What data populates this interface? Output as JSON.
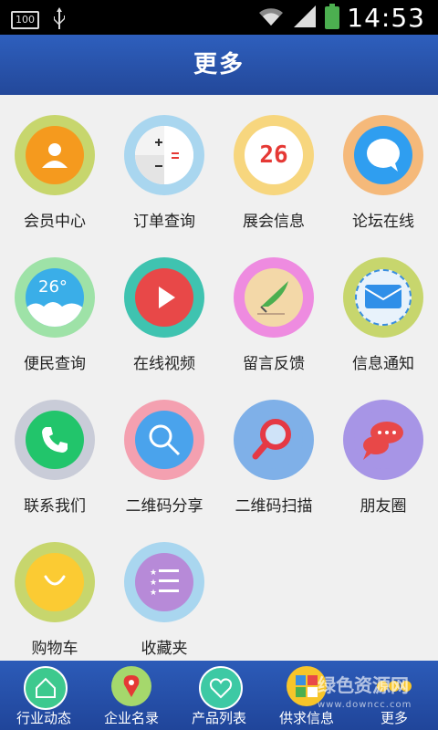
{
  "status_bar": {
    "battery": "100",
    "time": "14:53"
  },
  "header": {
    "title": "更多"
  },
  "grid": {
    "items": [
      {
        "label": "会员中心"
      },
      {
        "label": "订单查询"
      },
      {
        "label": "展会信息",
        "badge": "26"
      },
      {
        "label": "论坛在线"
      },
      {
        "label": "便民查询",
        "temp": "26°"
      },
      {
        "label": "在线视频"
      },
      {
        "label": "留言反馈"
      },
      {
        "label": "信息通知"
      },
      {
        "label": "联系我们"
      },
      {
        "label": "二维码分享"
      },
      {
        "label": "二维码扫描"
      },
      {
        "label": "朋友圈"
      },
      {
        "label": "购物车"
      },
      {
        "label": "收藏夹"
      }
    ]
  },
  "bottom_nav": {
    "items": [
      {
        "label": "行业动态"
      },
      {
        "label": "企业名录"
      },
      {
        "label": "产品列表"
      },
      {
        "label": "供求信息"
      },
      {
        "label": "更多"
      }
    ]
  },
  "watermark": {
    "text": "绿色资源网",
    "sub": "www.downcc.com"
  }
}
